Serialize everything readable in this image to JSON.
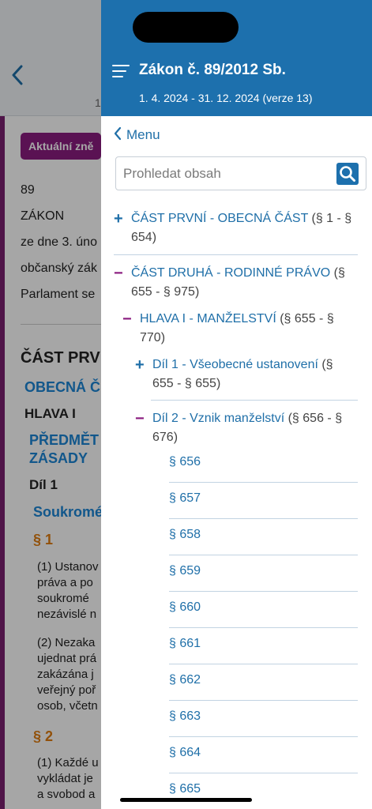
{
  "background": {
    "page_num": "1",
    "badge": "Aktuální zně",
    "lines": [
      "89",
      "ZÁKON",
      "ze dne 3. úno",
      "občanský zák",
      "Parlament se"
    ],
    "part_title": "ČÁST PRV",
    "part_subtitle": "OBECNÁ Č",
    "head": "HLAVA I",
    "subject_1": "PŘEDMĚT",
    "subject_2": "ZÁSADY",
    "dil": "Díl 1",
    "soukrome": "Soukromé",
    "s1": "§ 1",
    "p1": [
      "(1) Ustanov",
      "práva a po",
      "soukromé",
      "nezávislé n"
    ],
    "p2": [
      "(2) Nezaka",
      "ujednat prá",
      "zakázána j",
      "veřejný poř",
      "osob, včetn"
    ],
    "s2": "§ 2",
    "p3": [
      "(1) Každé u",
      "vykládat je",
      "a svobod a"
    ]
  },
  "drawer": {
    "title": "Zákon č. 89/2012 Sb.",
    "version": "1. 4. 2024 - 31. 12. 2024 (verze 13)",
    "back_label": "Menu",
    "search_placeholder": "Prohledat obsah",
    "toc": [
      {
        "toggle": "+",
        "title": "ČÁST PRVNÍ - OBECNÁ ČÁST",
        "range_line1": " (§ 1 - §",
        "range_line2": "654)"
      },
      {
        "toggle": "−",
        "title": "ČÁST DRUHÁ - RODINNÉ PRÁVO",
        "range_line1": " (§",
        "range_line2": "655 - § 975)"
      },
      {
        "toggle": "−",
        "title": "HLAVA I - MANŽELSTVÍ",
        "range_line1": " (§ 655 - §",
        "range_line2": "770)"
      },
      {
        "toggle": "+",
        "title": "Díl 1 - Všeobecné ustanovení",
        "range_line1": " (§",
        "range_line2": "655 - § 655)"
      },
      {
        "toggle": "−",
        "title": "Díl 2 - Vznik manželství",
        "range_line1": " (§ 656 - §",
        "range_line2": "676)"
      }
    ],
    "paragraphs": [
      "§ 656",
      "§ 657",
      "§ 658",
      "§ 659",
      "§ 660",
      "§ 661",
      "§ 662",
      "§ 663",
      "§ 664",
      "§ 665"
    ]
  },
  "colors": {
    "header_blue": "#1d70ad",
    "link_blue": "#1f6fa8",
    "toggle_purple": "#8b1d80",
    "badge_purple": "#8b1d80"
  },
  "icons": {
    "menu": "hamburger-icon",
    "back": "chevron-left-icon",
    "search": "search-icon"
  }
}
